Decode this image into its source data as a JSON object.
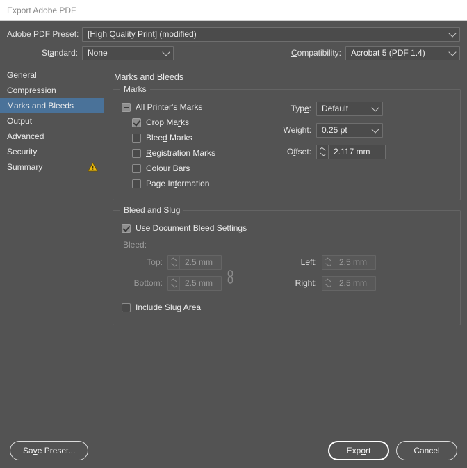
{
  "window": {
    "title": "Export Adobe PDF"
  },
  "top": {
    "preset_label": "Adobe PDF Preset:",
    "preset_value": "[High Quality Print] (modified)",
    "standard_label": "Standard:",
    "standard_value": "None",
    "compatibility_label": "Compatibility:",
    "compatibility_value": "Acrobat 5 (PDF 1.4)"
  },
  "sidebar": {
    "items": [
      {
        "label": "General",
        "selected": false,
        "warning": false
      },
      {
        "label": "Compression",
        "selected": false,
        "warning": false
      },
      {
        "label": "Marks and Bleeds",
        "selected": true,
        "warning": false
      },
      {
        "label": "Output",
        "selected": false,
        "warning": false
      },
      {
        "label": "Advanced",
        "selected": false,
        "warning": false
      },
      {
        "label": "Security",
        "selected": false,
        "warning": false
      },
      {
        "label": "Summary",
        "selected": false,
        "warning": true
      }
    ]
  },
  "panel": {
    "title": "Marks and Bleeds",
    "marks": {
      "legend": "Marks",
      "all_printers_marks": "All Printer's Marks",
      "all_printers_marks_state": "mixed",
      "checkboxes": [
        {
          "label": "Crop Marks",
          "state": "checked"
        },
        {
          "label": "Bleed Marks",
          "state": "unchecked"
        },
        {
          "label": "Registration Marks",
          "state": "unchecked"
        },
        {
          "label": "Colour Bars",
          "state": "unchecked"
        },
        {
          "label": "Page Information",
          "state": "unchecked"
        }
      ],
      "type_label": "Type:",
      "type_value": "Default",
      "weight_label": "Weight:",
      "weight_value": "0.25 pt",
      "offset_label": "Offset:",
      "offset_value": "2.117 mm"
    },
    "bleed_and_slug": {
      "legend": "Bleed and Slug",
      "use_document_bleed_label": "Use Document Bleed Settings",
      "use_document_bleed_state": "checked",
      "bleed_label": "Bleed:",
      "top_label": "Top:",
      "top_value": "2.5 mm",
      "bottom_label": "Bottom:",
      "bottom_value": "2.5 mm",
      "left_label": "Left:",
      "left_value": "2.5 mm",
      "right_label": "Right:",
      "right_value": "2.5 mm",
      "include_slug_label": "Include Slug Area",
      "include_slug_state": "unchecked"
    }
  },
  "footer": {
    "save_preset_label": "Save Preset...",
    "export_label": "Export",
    "cancel_label": "Cancel"
  },
  "colors": {
    "dialog_bg": "#535353",
    "selection_blue": "#4a7299",
    "warning_yellow": "#e8b914",
    "titlebar_bg": "#ffffff"
  }
}
